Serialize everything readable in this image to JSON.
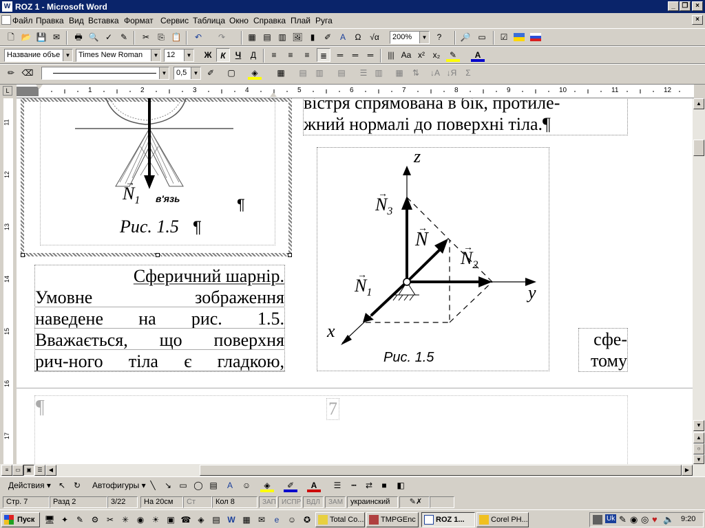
{
  "window": {
    "title": "ROZ 1 - Microsoft Word",
    "minimize": "_",
    "restore": "❐",
    "close": "×",
    "doc_close": "×"
  },
  "menu": [
    "Файл",
    "Правка",
    "Вид",
    "Вставка",
    "Формат",
    "Сервис",
    "Таблица",
    "Окно",
    "Справка",
    "Плай",
    "Руга"
  ],
  "format_toolbar": {
    "style": "Название объе",
    "font": "Times New Roman",
    "size": "12",
    "bold": "Ж",
    "italic": "К",
    "underline": "Ч",
    "zoom": "200%"
  },
  "drawing_toolbar_top": {
    "line_weight": "0,5"
  },
  "ruler": {
    "h_numbers": [
      "1",
      "2",
      "3",
      "4",
      "5",
      "6",
      "7",
      "8",
      "9",
      "10",
      "11",
      "12"
    ],
    "v_numbers": [
      "11",
      "12",
      "13",
      "14",
      "15",
      "16",
      "17"
    ]
  },
  "document": {
    "fig_left_label": "в'язь",
    "fig_left_n": "N",
    "fig_left_sub": "1",
    "fig_left_caption": "Рис. 1.5",
    "para_top_lines": [
      "вістря спрямована в бік, протиле-",
      "жний нормалі до поверхні тіла.¶"
    ],
    "body_lines": [
      "Сферичний шарнір.",
      "Умовне зображення",
      "наведене на рис. 1.5.",
      "Вважається, що поверхня",
      "рич-ного тіла є гладкою,"
    ],
    "right_fragment": [
      "сфе-",
      "тому"
    ],
    "pilcrow": "¶",
    "page_number": "7",
    "fig_right": {
      "z": "z",
      "y": "y",
      "x": "x",
      "n": "N",
      "n1": "N",
      "n1_sub": "1",
      "n2": "N",
      "n2_sub": "2",
      "n3": "N",
      "n3_sub": "3",
      "caption": "Рис. 1.5"
    }
  },
  "draw_bar": {
    "actions": "Действия ▾",
    "autoshapes": "Автофигуры ▾"
  },
  "status": {
    "page": "Стр. 7",
    "section": "Разд 2",
    "pages": "3/22",
    "at": "На 20см",
    "line": "Ст",
    "col": "Кол 8",
    "rec": "ЗАП",
    "trk": "ИСПР",
    "ext": "ВДЛ",
    "ovr": "ЗАМ",
    "lang": "украинский"
  },
  "taskbar": {
    "start": "Пуск",
    "tasks": [
      "Total Co...",
      "TMPGEnc",
      "ROZ 1...",
      "Corel PH..."
    ],
    "clock": "9:20",
    "lang": "Uk"
  },
  "colors": {
    "titlebar": "#0a246a",
    "face": "#d4d0c8",
    "page": "#ffffff"
  }
}
